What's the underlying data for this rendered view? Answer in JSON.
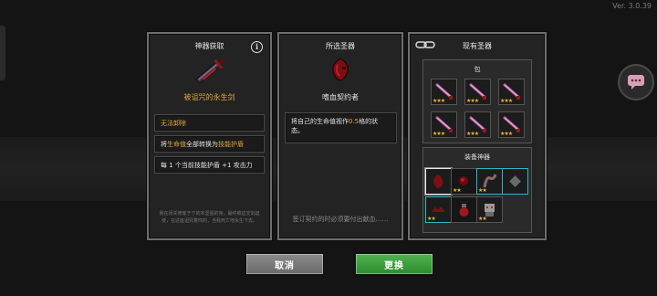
{
  "version": "Ver. 3.0.39",
  "panel_obtain": {
    "title": "神器获取",
    "weapon_name": "被诅咒的永生剑",
    "tag1": "无法卸除",
    "line2_pre": "将",
    "line2_hl1": "生命值",
    "line2_mid": "全部转换为",
    "line2_hl2": "技能护盾",
    "line3": "每 1 个当前技能护盾 +1 攻击力",
    "fine_print": "我在闭关修炼于下的本坚强的身，最终被这支剑迫使，在这座诅咒着你的，当我死亡地永生下去。"
  },
  "panel_selected": {
    "title": "所选圣器",
    "item_name": "嗜血契约者",
    "desc_pre": "将自己的生命值视作",
    "desc_hl": "0.5",
    "desc_post": "格的状态。",
    "footer": "签订契约的时必须要付出献血……"
  },
  "panel_owned": {
    "title": "现有圣器",
    "bag_label": "包",
    "equip_label": "装备神器"
  },
  "buttons": {
    "cancel": "取消",
    "replace": "更换"
  },
  "colors": {
    "highlight": "#e0a83a",
    "cyan_frame": "#2fb6c2",
    "confirm_green": "#3f9f3f"
  }
}
